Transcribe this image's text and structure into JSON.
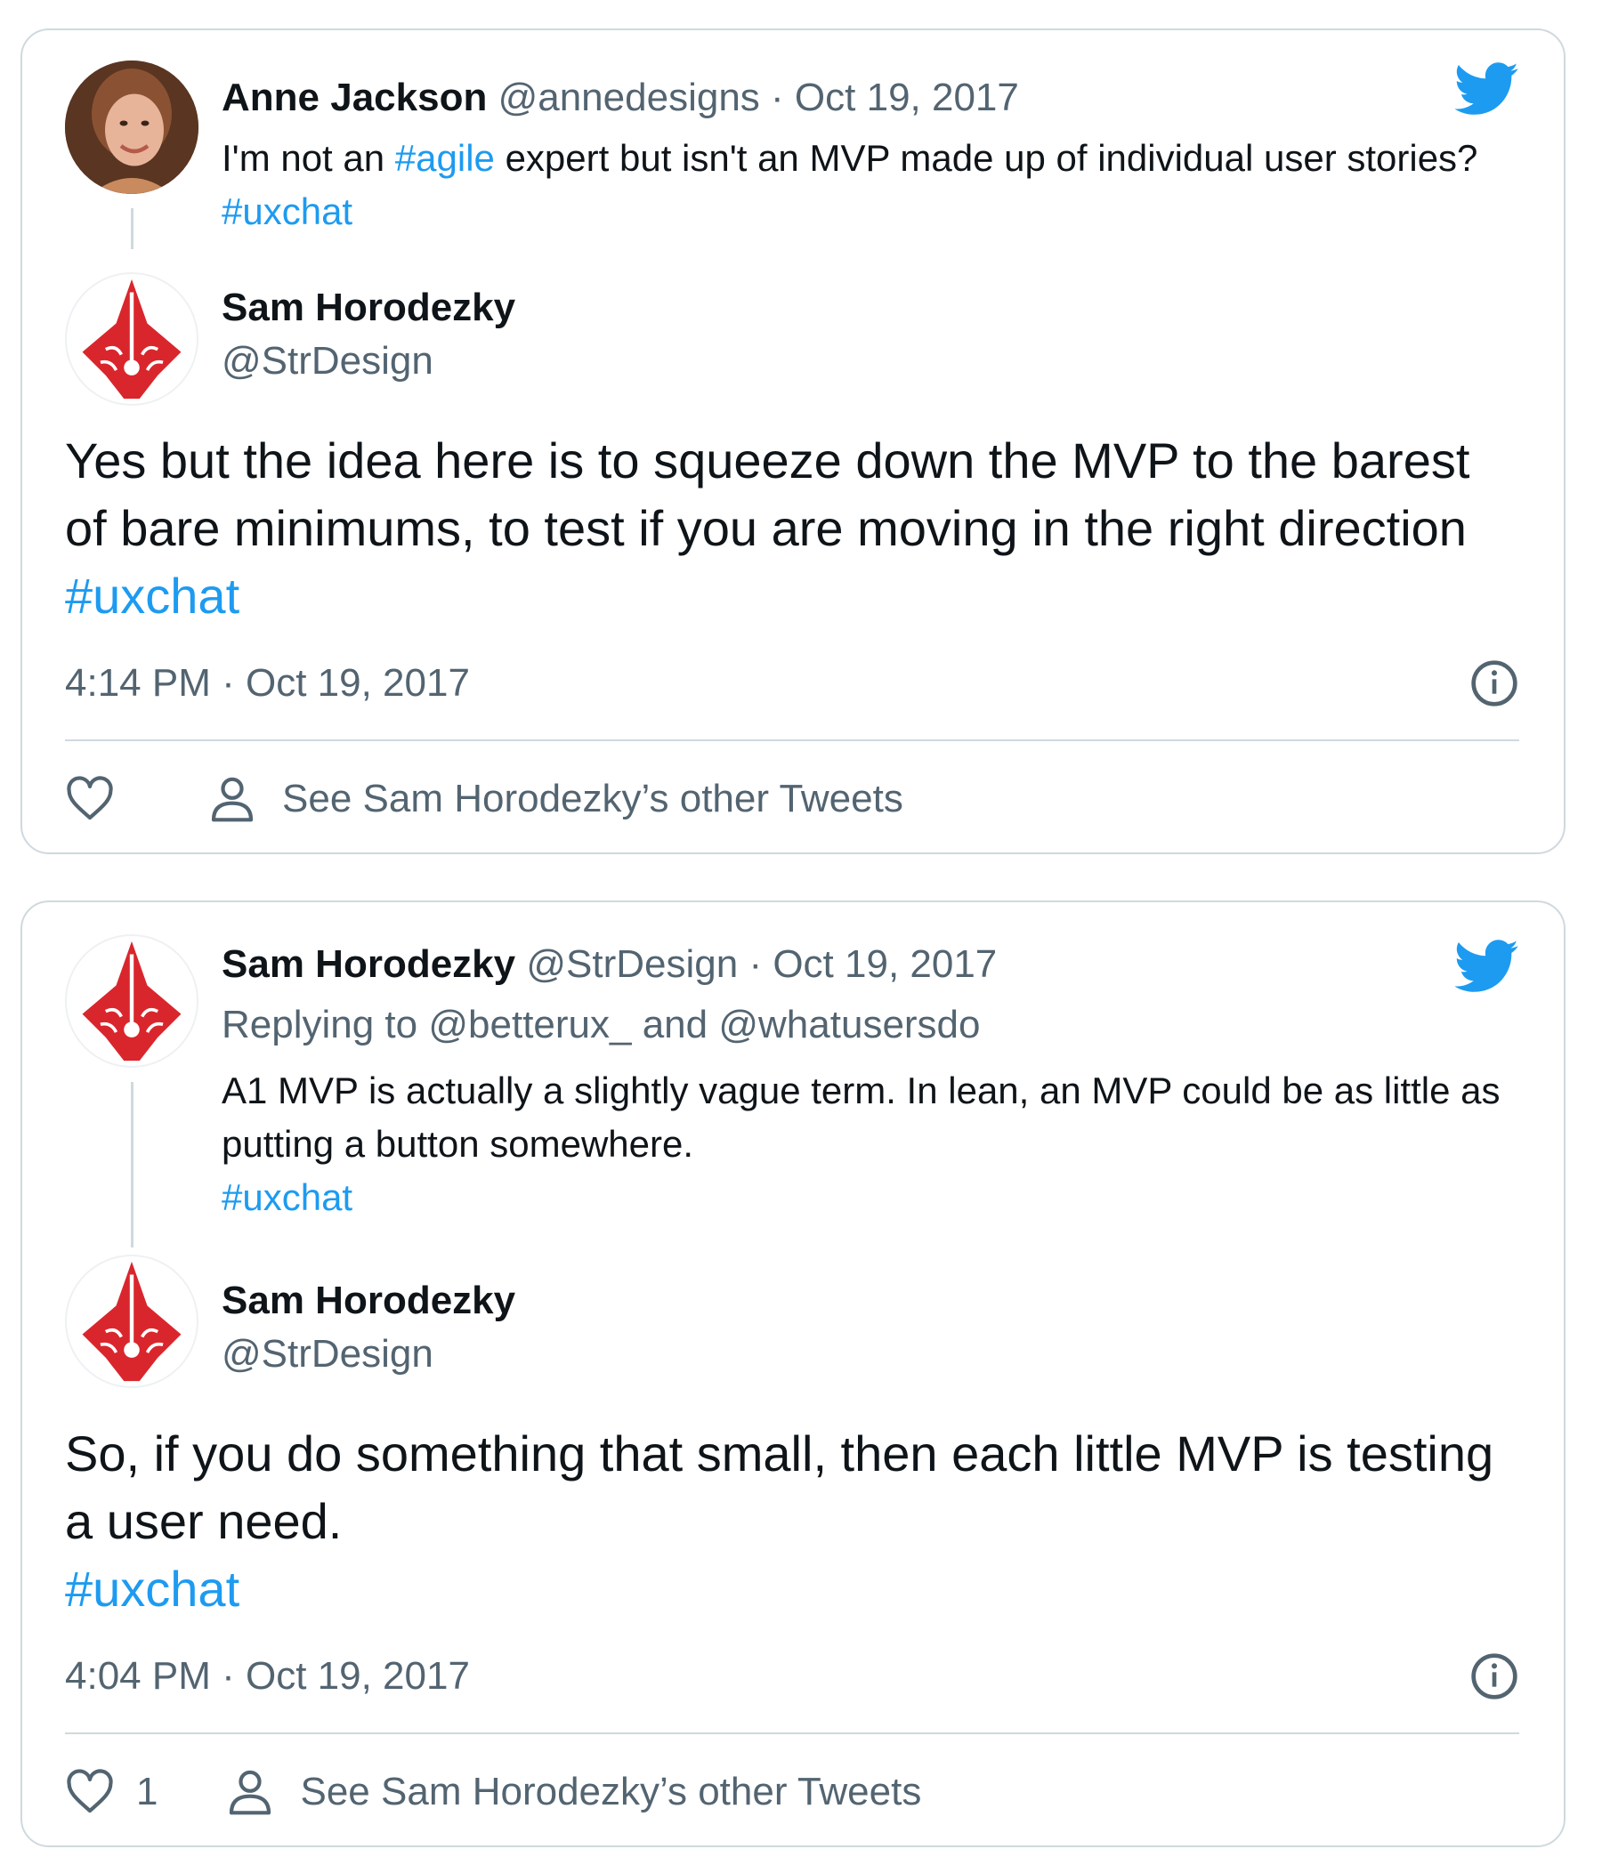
{
  "tweets": [
    {
      "quoted": {
        "name": "Anne Jackson",
        "handle": "@annedesigns",
        "date": "Oct 19, 2017",
        "text_before": "I'm not an ",
        "hashtag1": "#agile",
        "text_middle": " expert but isn't an MVP made up of individual user stories? ",
        "hashtag2": "#uxchat"
      },
      "author": {
        "name": "Sam Horodezky",
        "handle": "@StrDesign"
      },
      "text": "Yes but the idea here is to squeeze down the MVP to the barest of bare minimums, to test if you are moving in the right direction ",
      "hashtag": "#uxchat",
      "timestamp": "4:14 PM · Oct 19, 2017",
      "like_count": "",
      "see_other": "See Sam Horodezky’s other Tweets"
    },
    {
      "quoted": {
        "name": "Sam Horodezky",
        "handle": "@StrDesign",
        "date": "Oct 19, 2017",
        "replying_prefix": "Replying to ",
        "replying_to1": "@betterux_",
        "replying_and": " and ",
        "replying_to2": "@whatusersdo",
        "text": "A1 MVP is actually a slightly vague term. In lean, an MVP could be as little as putting a button somewhere.",
        "hashtag": "#uxchat"
      },
      "author": {
        "name": "Sam Horodezky",
        "handle": "@StrDesign"
      },
      "text": "So, if you do something that small, then each little MVP is testing a user need.",
      "hashtag": "#uxchat",
      "timestamp": "4:04 PM · Oct 19, 2017",
      "like_count": "1",
      "see_other": "See Sam Horodezky’s other Tweets"
    }
  ],
  "colors": {
    "link": "#1d9bf0",
    "secondary_text": "#536471",
    "border": "#cfd9de",
    "logo_red": "#d9262c"
  },
  "icons": [
    "twitter-bird-icon",
    "info-icon",
    "heart-icon",
    "person-icon"
  ]
}
